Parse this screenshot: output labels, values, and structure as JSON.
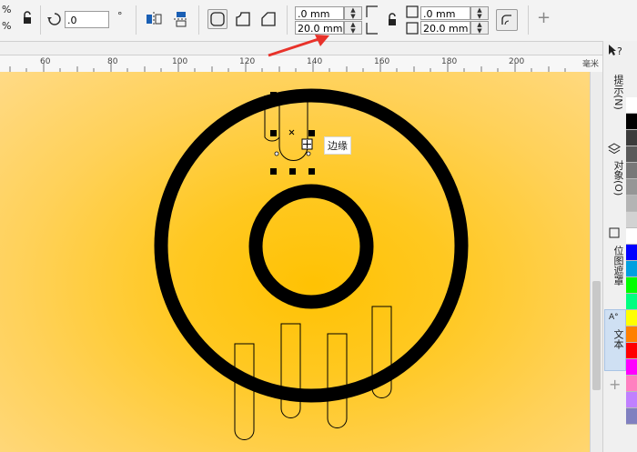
{
  "toolbar": {
    "percent_top": "%",
    "percent_bottom": "%",
    "rotation_value": ".0",
    "degree_symbol": "°",
    "pos_x": ".0 mm",
    "pos_y": "20.0 mm",
    "size_w": ".0 mm",
    "size_h": "20.0 mm",
    "add_symbol": "+"
  },
  "ruler": {
    "ticks": [
      "60",
      "80",
      "100",
      "120",
      "140",
      "160",
      "180",
      "200"
    ],
    "unit": "毫米"
  },
  "canvas": {
    "tooltip": "边缘"
  },
  "dock": {
    "help": "?",
    "tabs": [
      {
        "label": "提示(N)"
      },
      {
        "label": "对象(O)"
      },
      {
        "label": "位图遮罩"
      },
      {
        "label": "文本"
      }
    ],
    "add": "+"
  },
  "palette": [
    "#ffffff",
    "#000000",
    "#3c3c3c",
    "#5a5a5a",
    "#787878",
    "#969696",
    "#b4b4b4",
    "#d2d2d2",
    "#ffffff",
    "#0000ff",
    "#00a0e0",
    "#00ff00",
    "#00ff80",
    "#ffff00",
    "#ff8000",
    "#ff0000",
    "#ff00ff",
    "#ff80c0",
    "#c080ff",
    "#8080c0"
  ],
  "colors": {
    "accent_arrow": "#e8322a",
    "canvas_center": "#ffc203",
    "ring": "#000000"
  }
}
